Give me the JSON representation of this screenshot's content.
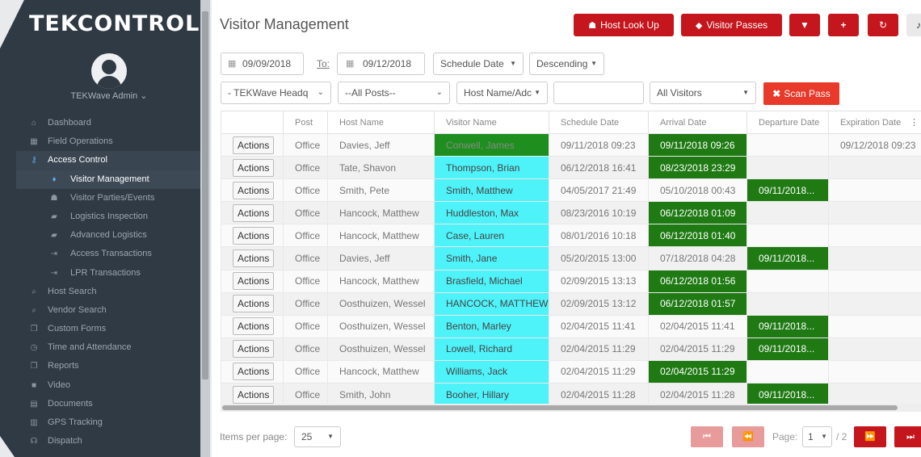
{
  "brand": "TEKCONTROL",
  "user": {
    "name": "TEKWave Admin ⌄"
  },
  "sidebar": {
    "items": [
      {
        "label": "Dashboard",
        "icon": "home-icon",
        "glyph": "⌂",
        "level": 0
      },
      {
        "label": "Field Operations",
        "icon": "grid-icon",
        "glyph": "▦",
        "level": 0
      },
      {
        "label": "Access Control",
        "icon": "key-icon",
        "glyph": "⚷",
        "level": 0,
        "state": "open"
      },
      {
        "label": "Visitor Management",
        "icon": "person-icon",
        "glyph": "♦",
        "level": 1,
        "state": "active"
      },
      {
        "label": "Visitor Parties/Events",
        "icon": "group-icon",
        "glyph": "☗",
        "level": 1
      },
      {
        "label": "Logistics Inspection",
        "icon": "truck-icon",
        "glyph": "▰",
        "level": 1
      },
      {
        "label": "Advanced Logistics",
        "icon": "truck-icon",
        "glyph": "▰",
        "level": 1
      },
      {
        "label": "Access Transactions",
        "icon": "sign-in-icon",
        "glyph": "⇥",
        "level": 1
      },
      {
        "label": "LPR Transactions",
        "icon": "sign-in-icon",
        "glyph": "⇥",
        "level": 1
      },
      {
        "label": "Host Search",
        "icon": "search-icon",
        "glyph": "⌕",
        "level": 0
      },
      {
        "label": "Vendor Search",
        "icon": "search-icon",
        "glyph": "⌕",
        "level": 0
      },
      {
        "label": "Custom Forms",
        "icon": "copy-icon",
        "glyph": "❐",
        "level": 0
      },
      {
        "label": "Time and Attendance",
        "icon": "clock-icon",
        "glyph": "◷",
        "level": 0
      },
      {
        "label": "Reports",
        "icon": "copy-icon",
        "glyph": "❐",
        "level": 0
      },
      {
        "label": "Video",
        "icon": "video-icon",
        "glyph": "■",
        "level": 0
      },
      {
        "label": "Documents",
        "icon": "file-icon",
        "glyph": "▤",
        "level": 0
      },
      {
        "label": "GPS Tracking",
        "icon": "map-icon",
        "glyph": "▥",
        "level": 0
      },
      {
        "label": "Dispatch",
        "icon": "headset-icon",
        "glyph": "☊",
        "level": 0
      }
    ]
  },
  "header": {
    "title": "Visitor Management",
    "buttons": {
      "host_lookup": "Host Look Up",
      "visitor_passes": "Visitor Passes"
    }
  },
  "filters": {
    "from_date": "09/09/2018",
    "to_label": "To:",
    "to_date": "09/12/2018",
    "date_type": "Schedule Date",
    "sort_order": "Descending",
    "site": "- TEKWave Headq",
    "post": "--All Posts--",
    "host_field": "Host Name/Adc",
    "search_value": "",
    "visitors": "All Visitors",
    "scan_pass": "Scan Pass"
  },
  "table": {
    "columns": [
      "",
      "Post",
      "Host Name",
      "Visitor Name",
      "Schedule Date",
      "Arrival Date",
      "Departure Date",
      "Expiration Date"
    ],
    "action_label": "Actions",
    "rows": [
      {
        "post": "Office",
        "host": "Davies, Jeff",
        "visitor": "Conwell, James",
        "schedule": "09/11/2018 09:23",
        "arrival": "09/11/2018 09:26",
        "departure": "",
        "expiration": "09/12/2018 09:23",
        "visitor_green": true,
        "arrival_green": true,
        "departure_green": false
      },
      {
        "post": "Office",
        "host": "Tate, Shavon",
        "visitor": "Thompson, Brian",
        "schedule": "06/12/2018 16:41",
        "arrival": "08/23/2018 23:29",
        "departure": "",
        "expiration": "",
        "visitor_green": false,
        "arrival_green": true,
        "departure_green": false
      },
      {
        "post": "Office",
        "host": "Smith, Pete",
        "visitor": "Smith, Matthew",
        "schedule": "04/05/2017 21:49",
        "arrival": "05/10/2018 00:43",
        "departure": "09/11/2018...",
        "expiration": "",
        "visitor_green": false,
        "arrival_green": false,
        "departure_green": true
      },
      {
        "post": "Office",
        "host": "Hancock, Matthew",
        "visitor": "Huddleston, Max",
        "schedule": "08/23/2016 10:19",
        "arrival": "06/12/2018 01:09",
        "departure": "",
        "expiration": "",
        "visitor_green": false,
        "arrival_green": true,
        "departure_green": false
      },
      {
        "post": "Office",
        "host": "Hancock, Matthew",
        "visitor": "Case, Lauren",
        "schedule": "08/01/2016 10:18",
        "arrival": "06/12/2018 01:40",
        "departure": "",
        "expiration": "",
        "visitor_green": false,
        "arrival_green": true,
        "departure_green": false
      },
      {
        "post": "Office",
        "host": "Davies, Jeff",
        "visitor": "Smith, Jane",
        "schedule": "05/20/2015 13:00",
        "arrival": "07/18/2018 04:28",
        "departure": "09/11/2018...",
        "expiration": "",
        "visitor_green": false,
        "arrival_green": false,
        "departure_green": true
      },
      {
        "post": "Office",
        "host": "Hancock, Matthew",
        "visitor": "Brasfield, Michael",
        "schedule": "02/09/2015 13:13",
        "arrival": "06/12/2018 01:56",
        "departure": "",
        "expiration": "",
        "visitor_green": false,
        "arrival_green": true,
        "departure_green": false
      },
      {
        "post": "Office",
        "host": "Oosthuizen, Wessel",
        "visitor": "HANCOCK, MATTHEW",
        "schedule": "02/09/2015 13:12",
        "arrival": "06/12/2018 01:57",
        "departure": "",
        "expiration": "",
        "visitor_green": false,
        "arrival_green": true,
        "departure_green": false
      },
      {
        "post": "Office",
        "host": "Oosthuizen, Wessel",
        "visitor": "Benton, Marley",
        "schedule": "02/04/2015 11:41",
        "arrival": "02/04/2015 11:41",
        "departure": "09/11/2018...",
        "expiration": "",
        "visitor_green": false,
        "arrival_green": false,
        "departure_green": true
      },
      {
        "post": "Office",
        "host": "Oosthuizen, Wessel",
        "visitor": "Lowell, Richard",
        "schedule": "02/04/2015 11:29",
        "arrival": "02/04/2015 11:29",
        "departure": "09/11/2018...",
        "expiration": "",
        "visitor_green": false,
        "arrival_green": false,
        "departure_green": true
      },
      {
        "post": "Office",
        "host": "Hancock, Matthew",
        "visitor": "Williams, Jack",
        "schedule": "02/04/2015 11:29",
        "arrival": "02/04/2015 11:29",
        "departure": "",
        "expiration": "",
        "visitor_green": false,
        "arrival_green": true,
        "departure_green": false
      },
      {
        "post": "Office",
        "host": "Smith, John",
        "visitor": "Booher, Hillary",
        "schedule": "02/04/2015 11:28",
        "arrival": "02/04/2015 11:28",
        "departure": "09/11/2018...",
        "expiration": "",
        "visitor_green": false,
        "arrival_green": false,
        "departure_green": true
      }
    ]
  },
  "pagination": {
    "items_per_page_label": "Items per page:",
    "items_per_page": "25",
    "page_label": "Page:",
    "current_page": "1",
    "total_pages": "/ 2"
  },
  "colors": {
    "accent_red": "#c4161c",
    "scan_red": "#e8392a",
    "cyan": "#4ef2f9",
    "green": "#1f7a14",
    "sidebar_bg": "#2f3a44"
  }
}
